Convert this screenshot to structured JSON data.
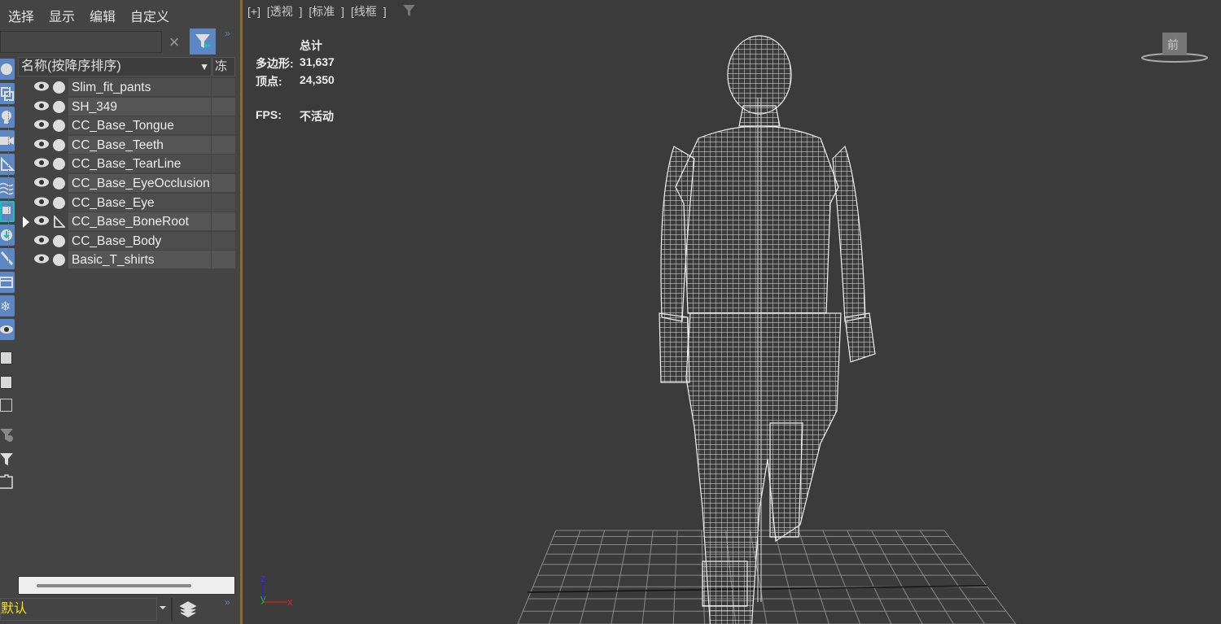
{
  "menu": [
    "选择",
    "显示",
    "编辑",
    "自定义"
  ],
  "search": {
    "value": "",
    "clear_icon": "×"
  },
  "explorer": {
    "column_name": "名称(按降序排序)",
    "column_freeze": "冻结",
    "items": [
      {
        "name": "Slim_fit_pants",
        "icon": "geometry"
      },
      {
        "name": "SH_349",
        "icon": "geometry"
      },
      {
        "name": "CC_Base_Tongue",
        "icon": "geometry"
      },
      {
        "name": "CC_Base_Teeth",
        "icon": "geometry"
      },
      {
        "name": "CC_Base_TearLine",
        "icon": "geometry"
      },
      {
        "name": "CC_Base_EyeOcclusion",
        "icon": "geometry"
      },
      {
        "name": "CC_Base_Eye",
        "icon": "geometry"
      },
      {
        "name": "CC_Base_BoneRoot",
        "icon": "bone",
        "expandable": true
      },
      {
        "name": "CC_Base_Body",
        "icon": "geometry"
      },
      {
        "name": "Basic_T_shirts",
        "icon": "geometry"
      }
    ]
  },
  "layer": {
    "value": "默认"
  },
  "viewport": {
    "labels": "[+]  [透视 ]  [标准 ]  [线框 ]",
    "stats": {
      "header": "总计",
      "poly_label": "多边形:",
      "poly_value": "31,637",
      "vert_label": "顶点:",
      "vert_value": "24,350",
      "fps_label": "FPS:",
      "fps_value": "不活动"
    },
    "axes": {
      "z": "z",
      "y": "y",
      "x": "x"
    },
    "viewcube_label": "前"
  },
  "colors": {
    "accent": "#5b87c4",
    "viewport_border": "#8a6d2c",
    "layer_text": "#f0e020"
  }
}
